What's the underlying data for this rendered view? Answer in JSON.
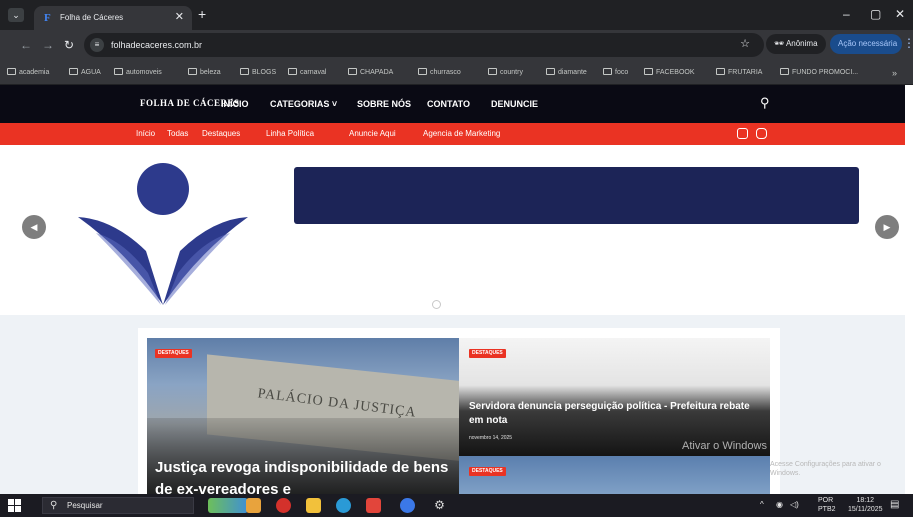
{
  "browser": {
    "tab_title": "Folha de Cáceres",
    "tab_favicon": "F",
    "new_tab": "+",
    "window_controls": [
      "–",
      "▢",
      "✕"
    ],
    "url": "folhadecaceres.com.br",
    "profile": "Anônima",
    "action_button": "Ação necessária"
  },
  "bookmarks": [
    "academia",
    "AGUA",
    "automoveis",
    "beleza",
    "BLOGS",
    "carnaval",
    "CHAPADA",
    "churrasco",
    "country",
    "diamante",
    "foco",
    "FACEBOOK",
    "FRUTARIA",
    "FUNDO PROMOCI..."
  ],
  "site": {
    "logo": "FOLHA DE CÁCERES",
    "nav": [
      "INÍCIO",
      "CATEGORIAS ˅",
      "SOBRE NÓS",
      "CONTATO",
      "DENUNCIE"
    ],
    "subnav": [
      "Início",
      "Todas",
      "Destaques",
      "Linha Política",
      "Anuncie Aqui",
      "Agencia de Marketing"
    ]
  },
  "cards": {
    "big": {
      "badge": "DESTAQUES",
      "title": "Justiça revoga indisponibilidade de bens de ex-vereadores e",
      "engraving": "PALÁCIO DA JUSTIÇA"
    },
    "right_top": {
      "badge": "DESTAQUES",
      "title": "Servidora denuncia perseguição política - Prefeitura rebate em nota",
      "date": "novembro 14, 2025"
    },
    "right_bottom": {
      "badge": "DESTAQUES"
    }
  },
  "watermark": {
    "title": "Ativar o Windows",
    "subtitle": "Acesse Configurações para ativar o Windows."
  },
  "taskbar": {
    "search_placeholder": "Pesquisar",
    "lang_line1": "POR",
    "lang_line2": "PTB2",
    "time": "18:12",
    "date": "15/11/2025"
  }
}
